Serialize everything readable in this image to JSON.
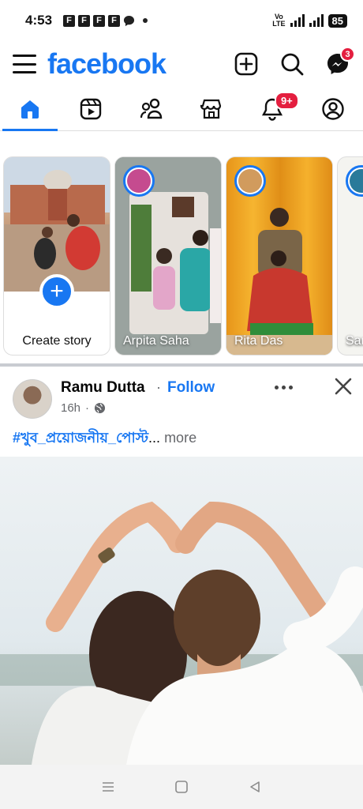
{
  "status_bar": {
    "time": "4:53",
    "notif_icons": [
      "F",
      "F",
      "F",
      "F"
    ],
    "network_label_top": "Vo",
    "network_label_bottom": "LTE",
    "battery": "85"
  },
  "header": {
    "logo": "facebook",
    "messenger_badge": "3"
  },
  "tabs": [
    {
      "name": "home",
      "active": true
    },
    {
      "name": "video"
    },
    {
      "name": "friends"
    },
    {
      "name": "marketplace"
    },
    {
      "name": "notifications",
      "badge": "9+"
    },
    {
      "name": "profile"
    }
  ],
  "stories": {
    "create_label": "Create story",
    "items": [
      {
        "name": "Arpita Saha"
      },
      {
        "name": "Rita Das"
      },
      {
        "name": "Sar"
      }
    ]
  },
  "post": {
    "author": "Ramu Dutta",
    "separator": "·",
    "follow_label": "Follow",
    "time": "16h",
    "meta_dot": "·",
    "text_tag": "#খুব_প্রয়োজনীয়_পোস্ট",
    "ellipsis": "...",
    "more_label": " more"
  },
  "colors": {
    "brand": "#1877f2",
    "badge": "#e41e3f"
  }
}
